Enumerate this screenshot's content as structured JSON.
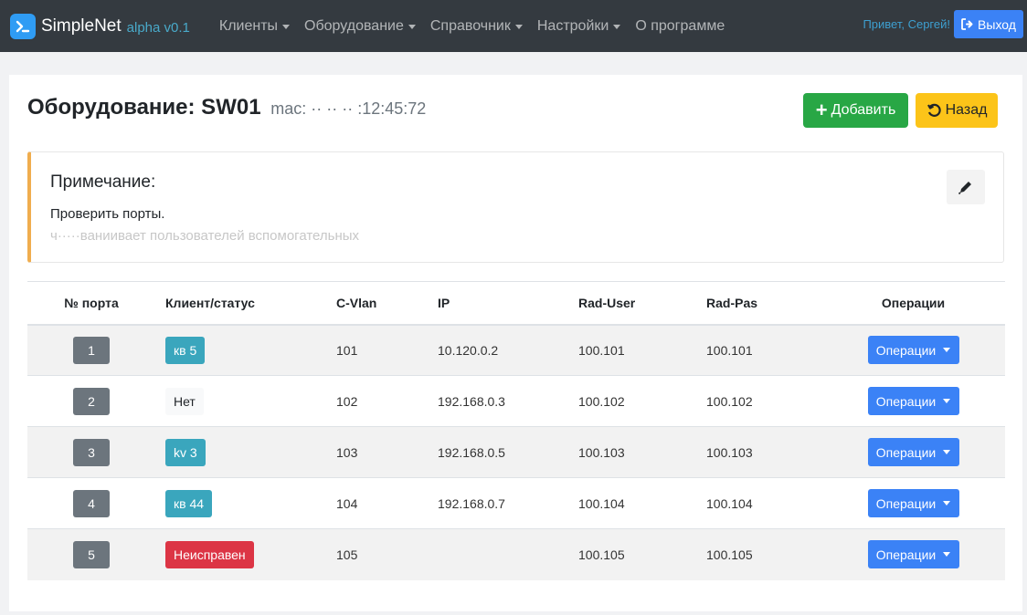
{
  "navbar": {
    "brand_name": "SimpleNet",
    "brand_version": "alpha v0.1",
    "menu": [
      {
        "label": "Клиенты",
        "has_dropdown": true
      },
      {
        "label": "Оборудование",
        "has_dropdown": true
      },
      {
        "label": "Справочник",
        "has_dropdown": true
      },
      {
        "label": "Настройки",
        "has_dropdown": true
      },
      {
        "label": "О программе",
        "has_dropdown": false
      }
    ],
    "greeting": "Привет, Сергей!",
    "logout_label": "Выход"
  },
  "page": {
    "title": "Оборудование: SW01",
    "mac": "mac: ·· ·· ·· :12:45:72",
    "add_label": "Добавить",
    "back_label": "Назад"
  },
  "note": {
    "title": "Примечание:",
    "text": "Проверить порты.",
    "text2": "ч·····ваниивает пользователей вспомогательных"
  },
  "table": {
    "headers": [
      "№ порта",
      "Клиент/статус",
      "C-Vlan",
      "IP",
      "Rad-User",
      "Rad-Pas",
      "Операции"
    ],
    "rows": [
      {
        "port": "1",
        "client": "кв 5",
        "client_style": "info",
        "vlan": "101",
        "ip": "10.120.0.2",
        "rad_user": "100.101",
        "rad_pas": "100.101",
        "ops": "Операции"
      },
      {
        "port": "2",
        "client": "Нет",
        "client_style": "light",
        "vlan": "102",
        "ip": "192.168.0.3",
        "rad_user": "100.102",
        "rad_pas": "100.102",
        "ops": "Операции"
      },
      {
        "port": "3",
        "client": "kv 3",
        "client_style": "info",
        "vlan": "103",
        "ip": "192.168.0.5",
        "rad_user": "100.103",
        "rad_pas": "100.103",
        "ops": "Операции"
      },
      {
        "port": "4",
        "client": "кв 44",
        "client_style": "info",
        "vlan": "104",
        "ip": "192.168.0.7",
        "rad_user": "100.104",
        "rad_pas": "100.104",
        "ops": "Операции"
      },
      {
        "port": "5",
        "client": "Неисправен",
        "client_style": "danger",
        "vlan": "105",
        "ip": "",
        "rad_user": "100.105",
        "rad_pas": "100.105",
        "ops": "Операции"
      }
    ]
  },
  "colors": {
    "navbar": "#343a40",
    "primary": "#3b82f6",
    "success": "#28a745",
    "warning": "#fcc419",
    "info": "#3aa6bd",
    "danger": "#dc3545",
    "secondary": "#6c757d"
  },
  "icons": {
    "brand": "terminal-icon",
    "logout": "sign-out-icon",
    "add": "plus-icon",
    "back": "undo-icon",
    "edit": "pencil-icon"
  }
}
